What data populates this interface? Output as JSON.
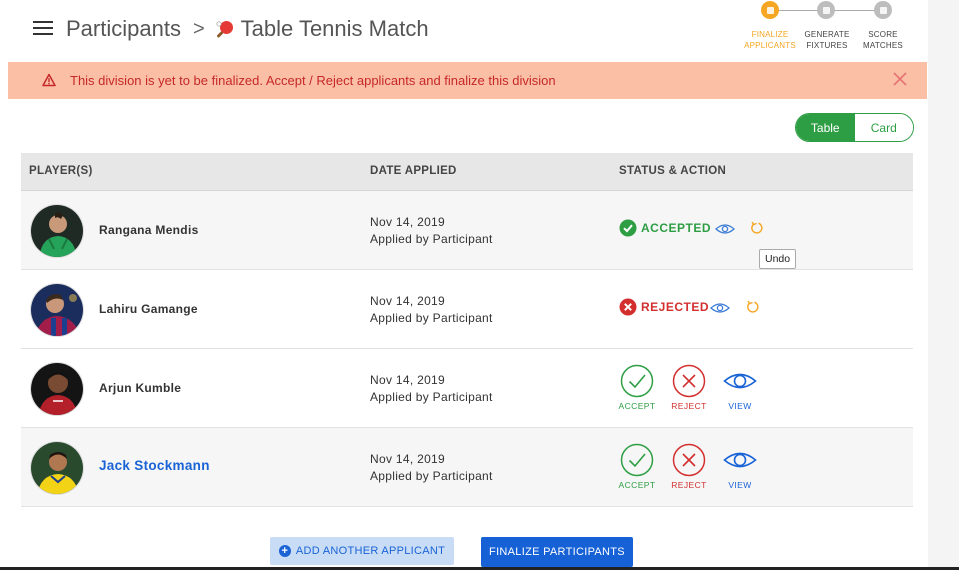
{
  "header": {
    "breadcrumb_root": "Participants",
    "breadcrumb_sep": ">",
    "breadcrumb_current": "Table Tennis Match"
  },
  "stepper": {
    "steps": [
      {
        "line1": "FINALIZE",
        "line2": "APPLICANTS",
        "state": "active"
      },
      {
        "line1": "GENERATE",
        "line2": "FIXTURES",
        "state": "inactive"
      },
      {
        "line1": "SCORE",
        "line2": "MATCHES",
        "state": "inactive"
      }
    ]
  },
  "alert": {
    "text": "This division is yet to be finalized. Accept / Reject applicants and finalize this division"
  },
  "view_toggle": {
    "table": "Table",
    "card": "Card",
    "selected": "Table"
  },
  "table": {
    "headers": {
      "players": "PLAYER(S)",
      "date": "DATE APPLIED",
      "status": "STATUS & ACTION"
    },
    "rows": [
      {
        "name": "Rangana Mendis",
        "date": "Nov 14, 2019",
        "applied_by": "Applied by Participant",
        "status": "ACCEPTED"
      },
      {
        "name": "Lahiru Gamange",
        "date": "Nov 14, 2019",
        "applied_by": "Applied by Participant",
        "status": "REJECTED"
      },
      {
        "name": "Arjun Kumble",
        "date": "Nov 14, 2019",
        "applied_by": "Applied by Participant",
        "status": "pending"
      },
      {
        "name": "Jack Stockmann",
        "date": "Nov 14, 2019",
        "applied_by": "Applied by Participant",
        "status": "pending"
      }
    ],
    "actions": {
      "accept": "ACCEPT",
      "reject": "REJECT",
      "view": "VIEW"
    }
  },
  "tooltip": {
    "text": "Undo"
  },
  "footer": {
    "add_label": "ADD ANOTHER APPLICANT",
    "finalize_label": "FINALIZE PARTICIPANTS"
  },
  "colors": {
    "accent_orange": "#f5a623",
    "success_green": "#2e9e44",
    "danger_red": "#d32f2f",
    "primary_blue": "#1661d6",
    "alert_bg": "#fbbfa6"
  },
  "icons": [
    "menu-icon",
    "paddle-icon",
    "warning-icon",
    "close-icon",
    "check-circle-icon",
    "x-circle-icon",
    "eye-icon",
    "undo-icon",
    "plus-circle-icon"
  ]
}
